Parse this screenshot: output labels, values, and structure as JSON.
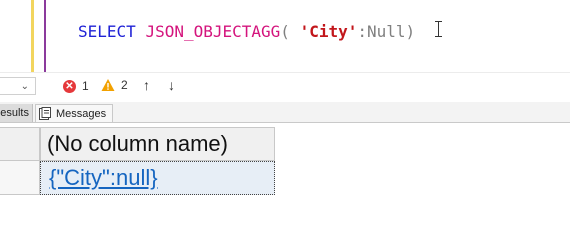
{
  "editor": {
    "tokens": {
      "select": "SELECT ",
      "func": "JSON_OBJECTAGG",
      "open_paren": "( ",
      "key": "'City'",
      "colon": ":",
      "value": "Null",
      "close_paren": ")"
    }
  },
  "status": {
    "error_icon_glyph": "✕",
    "error_count": "1",
    "warning_count": "2",
    "up_arrow": "↑",
    "down_arrow": "↓"
  },
  "tabs": {
    "results_label": "esults",
    "messages_label": "Messages"
  },
  "grid": {
    "column_header": "(No column name)",
    "rows": [
      {
        "value": "{\"City\":null}"
      }
    ]
  },
  "colors": {
    "keyword": "#1f22d6",
    "function": "#d4147d",
    "string": "#c2161b",
    "link": "#1565c0",
    "error": "#e5383b",
    "warning": "#f2a100"
  }
}
